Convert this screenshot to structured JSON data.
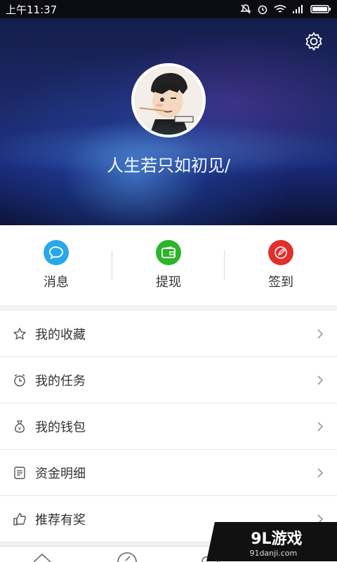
{
  "status": {
    "time": "上午11:37"
  },
  "profile": {
    "username": "人生若只如初见/"
  },
  "actions": [
    {
      "label": "消息",
      "color": "#29a8e8",
      "icon": "chat-icon"
    },
    {
      "label": "提现",
      "color": "#2bb52b",
      "icon": "wallet-icon"
    },
    {
      "label": "签到",
      "color": "#e0302b",
      "icon": "pencil-icon"
    }
  ],
  "menu": [
    {
      "label": "我的收藏",
      "icon": "star-icon"
    },
    {
      "label": "我的任务",
      "icon": "clock-icon"
    },
    {
      "label": "我的钱包",
      "icon": "money-bag-icon"
    },
    {
      "label": "资金明细",
      "icon": "document-list-icon"
    },
    {
      "label": "推荐有奖",
      "icon": "thumbs-up-icon"
    }
  ],
  "watermark": {
    "brand": "9L游戏",
    "site": "91danji.com"
  }
}
